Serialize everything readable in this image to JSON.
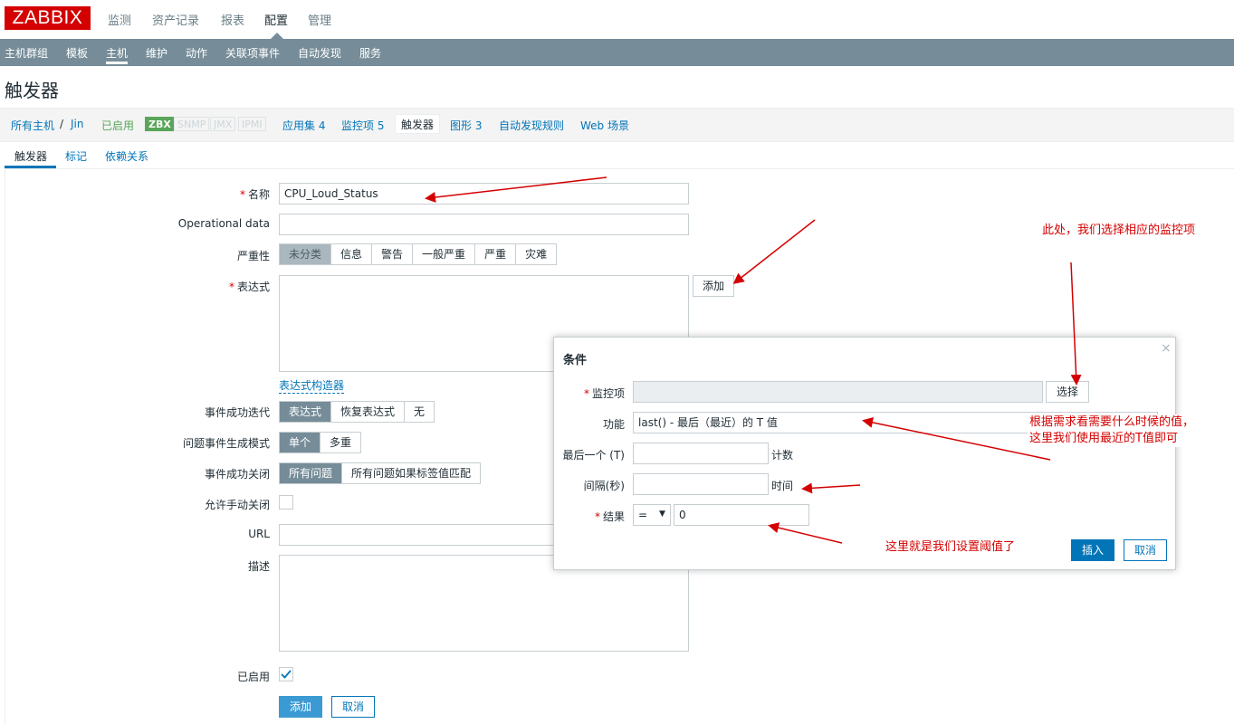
{
  "app": {
    "logo": "ZABBIX",
    "main_menu": [
      "监测",
      "资产记录",
      "报表",
      "配置",
      "管理"
    ],
    "sub_menu": [
      "主机群组",
      "模板",
      "主机",
      "维护",
      "动作",
      "关联项事件",
      "自动发现",
      "服务"
    ]
  },
  "page": {
    "title": "触发器"
  },
  "breadcrumb": {
    "all_hosts": "所有主机",
    "sep": "/",
    "host": "Jin",
    "enabled": "已启用",
    "tags": [
      "ZBX",
      "SNMP",
      "JMX",
      "IPMI"
    ],
    "app_sets": "应用集 4",
    "items": "监控项 5",
    "triggers": "触发器",
    "graphs": "图形 3",
    "discovery": "自动发现规则",
    "web": "Web 场景"
  },
  "tabs": [
    "触发器",
    "标记",
    "依赖关系"
  ],
  "form": {
    "name_label": "名称",
    "name_value": "CPU_Loud_Status",
    "opdata_label": "Operational data",
    "severity_label": "严重性",
    "severity_options": [
      "未分类",
      "信息",
      "警告",
      "一般严重",
      "严重",
      "灾难"
    ],
    "expression_label": "表达式",
    "add_button": "添加",
    "constructor_link": "表达式构造器",
    "ok_event_label": "事件成功迭代",
    "ok_event_options": [
      "表达式",
      "恢复表达式",
      "无"
    ],
    "problem_mode_label": "问题事件生成模式",
    "problem_mode_options": [
      "单个",
      "多重"
    ],
    "ok_close_label": "事件成功关闭",
    "ok_close_options": [
      "所有问题",
      "所有问题如果标签值匹配"
    ],
    "manual_close_label": "允许手动关闭",
    "url_label": "URL",
    "desc_label": "描述",
    "enabled_label": "已启用",
    "submit_button": "添加",
    "cancel_button": "取消"
  },
  "dialog": {
    "title": "条件",
    "close_glyph": "×",
    "item_label": "监控项",
    "select_button": "选择",
    "function_label": "功能",
    "function_value": "last() - 最后（最近）的 T 值",
    "last_label": "最后一个 (T)",
    "last_unit": "计数",
    "interval_label": "间隔(秒)",
    "interval_unit": "时间",
    "result_label": "结果",
    "result_operator": "=",
    "result_value": "0",
    "insert_button": "插入",
    "cancel_button": "取消"
  },
  "annotations": {
    "select_item": "此处，我们选择相应的监控项",
    "last_value_line1": "根据需求看需要什么时候的值，",
    "last_value_line2": "这里我们使用最近的T值即可",
    "threshold": "这里就是我们设置阈值了"
  },
  "colors": {
    "brand": "#d40000",
    "nav": "#768d99",
    "link": "#0275b8",
    "annotation": "#d40000"
  }
}
